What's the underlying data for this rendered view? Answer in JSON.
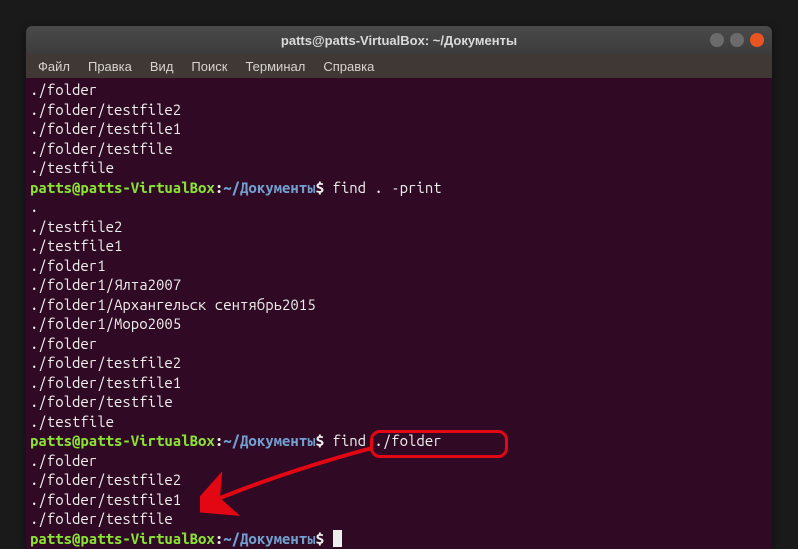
{
  "titlebar": {
    "title": "patts@patts-VirtualBox: ~/Документы"
  },
  "menubar": {
    "items": [
      "Файл",
      "Правка",
      "Вид",
      "Поиск",
      "Терминал",
      "Справка"
    ]
  },
  "prompt": {
    "user_host": "patts@patts-VirtualBox",
    "colon": ":",
    "path": "~/Документы",
    "dollar": "$"
  },
  "terminal": {
    "block1": [
      "./folder",
      "./folder/testfile2",
      "./folder/testfile1",
      "./folder/testfile",
      "./testfile"
    ],
    "cmd1": " find . -print",
    "block2": [
      ".",
      "./testfile2",
      "./testfile1",
      "./folder1",
      "./folder1/Ялта2007",
      "./folder1/Архангельск сентябрь2015",
      "./folder1/Моро2005",
      "./folder",
      "./folder/testfile2",
      "./folder/testfile1",
      "./folder/testfile",
      "./testfile"
    ],
    "cmd2": " find ./folder",
    "block3": [
      "./folder",
      "./folder/testfile2",
      "./folder/testfile1",
      "./folder/testfile"
    ],
    "cmd3": " "
  }
}
